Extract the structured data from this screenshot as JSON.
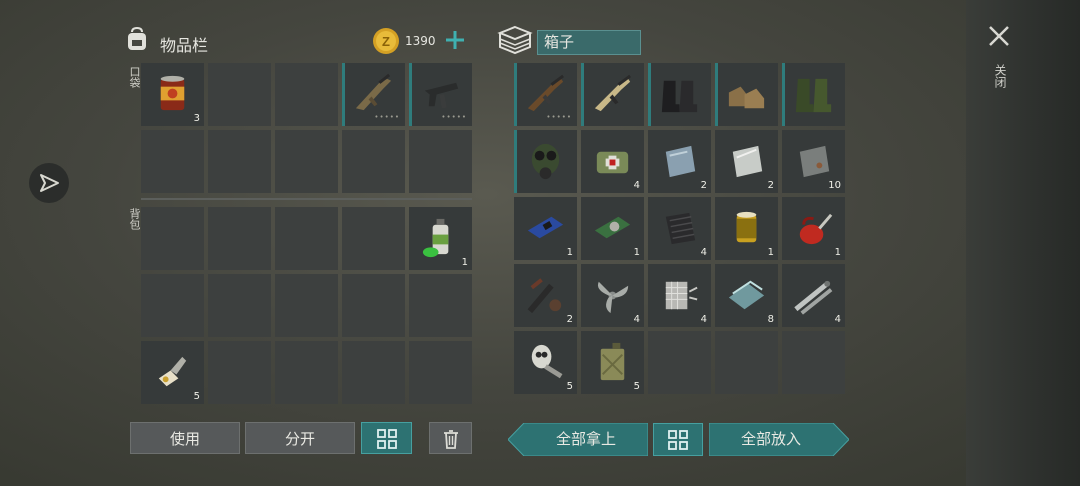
{
  "left": {
    "title": "物品栏",
    "coins": "1390",
    "pocket_label": "口袋",
    "backpack_label": "背包",
    "pocket_slots": [
      {
        "icon": "canned-food-icon",
        "count": "3"
      },
      null,
      null,
      {
        "icon": "assault-rifle-icon",
        "count": "",
        "dots": "•••••",
        "stripe": true
      },
      {
        "icon": "smg-icon",
        "count": "",
        "dots": "•••••",
        "stripe": true
      },
      null,
      null,
      null,
      null,
      null
    ],
    "backpack_slots": [
      null,
      null,
      null,
      null,
      {
        "icon": "spray-can-icon",
        "count": "1"
      },
      null,
      null,
      null,
      null,
      null,
      {
        "icon": "lockpick-icon",
        "count": "5"
      },
      null,
      null,
      null,
      null
    ]
  },
  "right": {
    "title": "箱子",
    "slots": [
      {
        "icon": "ak-rifle-icon",
        "count": "",
        "dots": "•••••",
        "stripe": true
      },
      {
        "icon": "rifle-skin-icon",
        "count": "",
        "stripe": true
      },
      {
        "icon": "black-boots-icon",
        "count": "",
        "stripe": true
      },
      {
        "icon": "brown-boots-icon",
        "count": "",
        "stripe": true
      },
      {
        "icon": "rubber-boots-icon",
        "count": "",
        "stripe": true
      },
      {
        "icon": "gas-mask-icon",
        "count": "",
        "stripe": true
      },
      {
        "icon": "medkit-bag-icon",
        "count": "4"
      },
      {
        "icon": "steel-sheet-icon",
        "count": "2"
      },
      {
        "icon": "metal-plate-icon",
        "count": "2"
      },
      {
        "icon": "iron-plate-icon",
        "count": "10"
      },
      {
        "icon": "circuit-board-icon",
        "count": "1"
      },
      {
        "icon": "sensor-board-icon",
        "count": "1"
      },
      {
        "icon": "carbon-fiber-icon",
        "count": "4"
      },
      {
        "icon": "oil-filter-icon",
        "count": "1"
      },
      {
        "icon": "oil-can-icon",
        "count": "1"
      },
      {
        "icon": "scope-parts-icon",
        "count": "2"
      },
      {
        "icon": "propeller-icon",
        "count": "4"
      },
      {
        "icon": "metal-mesh-icon",
        "count": "4"
      },
      {
        "icon": "glass-pane-icon",
        "count": "8"
      },
      {
        "icon": "pipes-icon",
        "count": "4"
      },
      {
        "icon": "engine-parts-icon",
        "count": "5"
      },
      {
        "icon": "jerry-can-icon",
        "count": "5"
      },
      null,
      null,
      null
    ]
  },
  "buttons": {
    "use": "使用",
    "split": "分开",
    "take_all": "全部拿上",
    "put_all": "全部放入"
  },
  "close_label": "关闭"
}
